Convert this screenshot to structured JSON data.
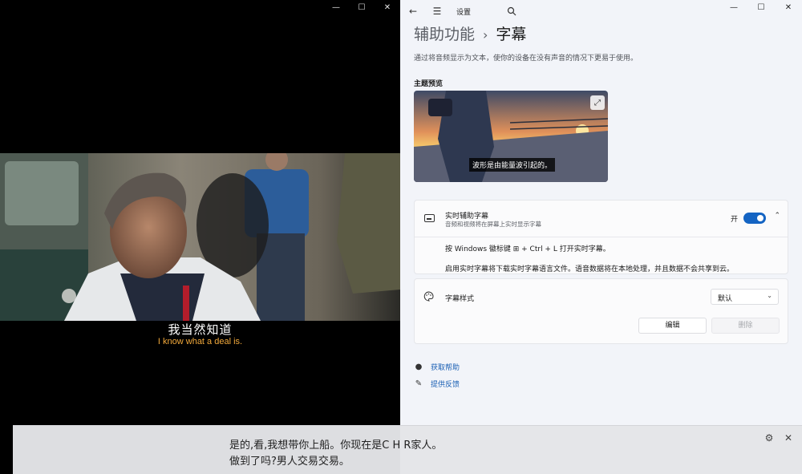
{
  "player": {
    "window_controls": {
      "minimize": "—",
      "maximize": "☐",
      "close": "✕"
    },
    "subtitle_cn": "我当然知道",
    "subtitle_en": "I know what a deal is.",
    "colors": {
      "subtitle_en": "#f2a93b"
    }
  },
  "settings": {
    "titlebar": {
      "back_icon": "arrow-left-icon",
      "menu_icon": "hamburger-icon",
      "title": "设置",
      "search_icon": "search-icon"
    },
    "window_controls": {
      "minimize": "—",
      "maximize": "☐",
      "close": "✕"
    },
    "breadcrumb": {
      "parent": "辅助功能",
      "separator": "›",
      "current": "字幕"
    },
    "description": "通过将音频显示为文本，使你的设备在没有声音的情况下更易于使用。",
    "preview": {
      "label": "主题预览",
      "caption": "波形是由能量波引起的。",
      "expand_icon": "expand-icon"
    },
    "live_captions": {
      "title": "实时辅助字幕",
      "subtitle": "音频和视频将在屏幕上实时显示字幕",
      "toggle_label": "开",
      "toggle_on": true,
      "hint_shortcut": "按 Windows 徽标键 ⊞ + Ctrl + L 打开实时字幕。",
      "hint_download": "启用实时字幕将下载实时字幕语言文件。语音数据将在本地处理，并且数据不会共享到云。"
    },
    "caption_style": {
      "title": "字幕样式",
      "selected": "默认",
      "edit_label": "编辑",
      "delete_label": "删除"
    },
    "links": {
      "help": "获取帮助",
      "feedback": "提供反馈"
    },
    "colors": {
      "accent": "#1464c3",
      "link": "#1a5fb4",
      "background": "#f2f4f9"
    }
  },
  "live_caption_bar": {
    "line1": "是的,看,我想带你上船。你现在是C H R家人。",
    "line2": "做到了吗?男人交易交易。",
    "settings_icon": "gear-icon",
    "close_icon": "close-icon"
  }
}
